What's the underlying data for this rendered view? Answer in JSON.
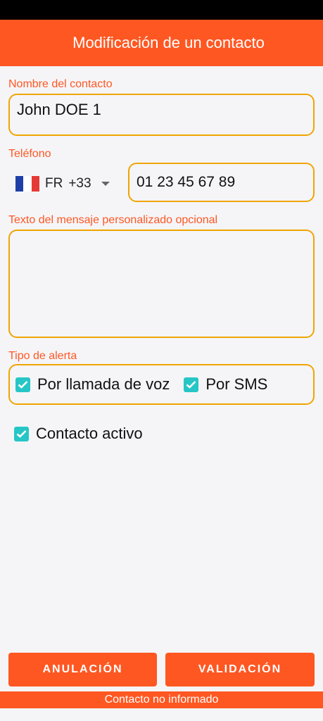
{
  "header": {
    "title": "Modificación de un contacto"
  },
  "form": {
    "name_label": "Nombre del contacto",
    "name_value": "John DOE 1",
    "phone_label": "Teléfono",
    "country_code": "FR",
    "dial_code": "+33",
    "phone_value": "01 23 45 67 89",
    "message_label": "Texto del mensaje personalizado opcional",
    "message_value": "",
    "alert_label": "Tipo de alerta",
    "alert_voice": "Por llamada de voz",
    "alert_sms": "Por SMS",
    "active_label": "Contacto activo"
  },
  "actions": {
    "cancel": "ANULACIÓN",
    "validate": "VALIDACIÓN"
  },
  "footer": {
    "status": "Contacto no informado"
  },
  "checkboxes": {
    "voice": true,
    "sms": true,
    "active": true
  },
  "colors": {
    "accent": "#ff5722",
    "field_border": "#f0a500",
    "checkbox": "#26c6c6"
  }
}
